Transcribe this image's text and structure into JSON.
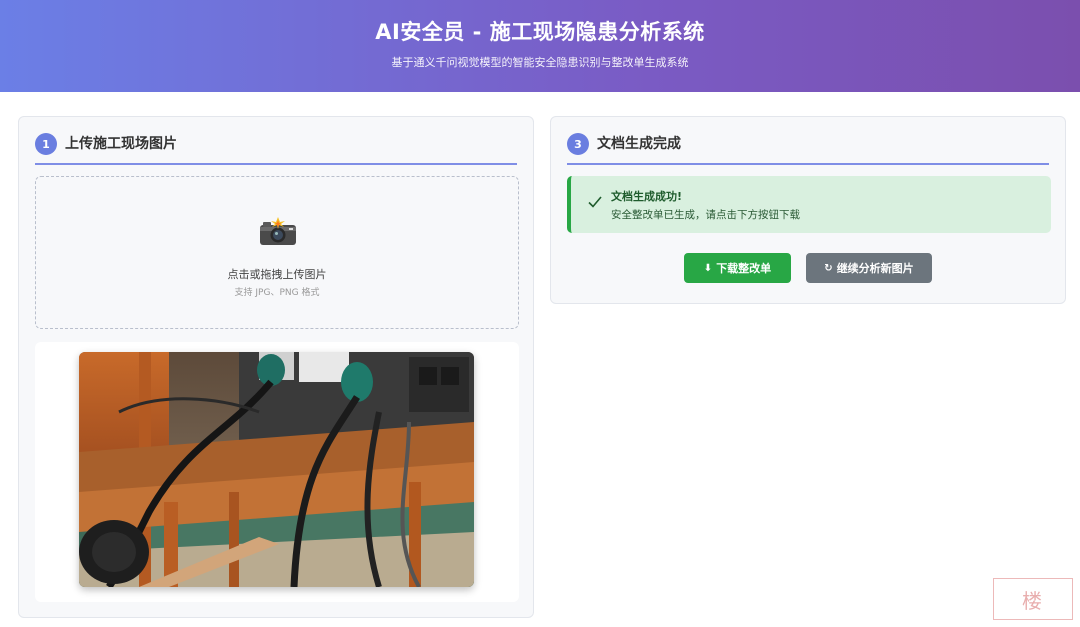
{
  "header": {
    "title": "AI安全员 - 施工现场隐患分析系统",
    "subtitle": "基于通义千问视觉模型的智能安全隐患识别与整改单生成系统"
  },
  "upload_panel": {
    "step": "1",
    "title": "上传施工现场图片",
    "upload_text": "点击或拖拽上传图片",
    "upload_hint": "支持 JPG、PNG 格式"
  },
  "result_panel": {
    "step": "3",
    "title": "文档生成完成",
    "success_title": "文档生成成功!",
    "success_message": "安全整改单已生成，请点击下方按钮下载",
    "download_button": "下载整改单",
    "continue_button": "继续分析新图片"
  },
  "watermark": "楼",
  "colors": {
    "accent": "#6a7ee0",
    "success": "#28a745",
    "secondary": "#6c757d"
  },
  "icons": {
    "camera": "camera-icon",
    "check": "check-icon",
    "download": "download-icon",
    "refresh": "refresh-icon"
  }
}
